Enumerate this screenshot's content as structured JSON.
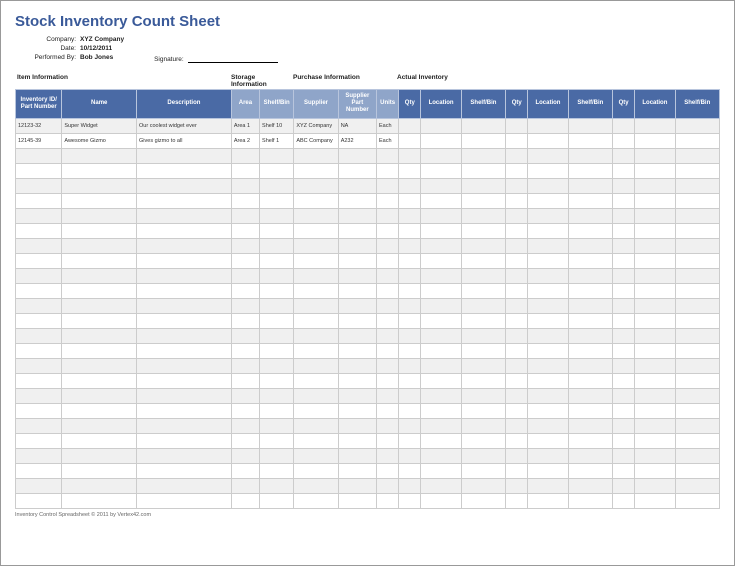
{
  "title": "Stock Inventory Count Sheet",
  "meta": {
    "labels": {
      "company": "Company:",
      "date": "Date:",
      "performed_by": "Performed By:",
      "signature": "Signature:"
    },
    "company": "XYZ Company",
    "date": "10/12/2011",
    "performed_by": "Bob Jones"
  },
  "sections": {
    "item": "Item Information",
    "storage": "Storage Information",
    "purchase": "Purchase Information",
    "actual": "Actual Inventory"
  },
  "columns": {
    "inv_id": "Inventory ID/ Part Number",
    "name": "Name",
    "description": "Description",
    "area": "Area",
    "shelf_bin": "Shelf/Bin",
    "supplier": "Supplier",
    "supplier_part": "Supplier Part Number",
    "units": "Units",
    "qty": "Qty",
    "location": "Location"
  },
  "rows": [
    {
      "id": "12123-32",
      "name": "Super Widget",
      "desc": "Our coolest widget ever",
      "area": "Area 1",
      "shelf": "Shelf 10",
      "supplier": "XYZ Company",
      "spart": "NA",
      "units": "Each"
    },
    {
      "id": "12145-39",
      "name": "Awesome Gizmo",
      "desc": "Gives gizmo to all",
      "area": "Area 2",
      "shelf": "Shelf 1",
      "supplier": "ABC Company",
      "spart": "A232",
      "units": "Each"
    }
  ],
  "empty_row_count": 24,
  "footer": "Inventory Control Spreadsheet © 2011 by Vertex42.com"
}
